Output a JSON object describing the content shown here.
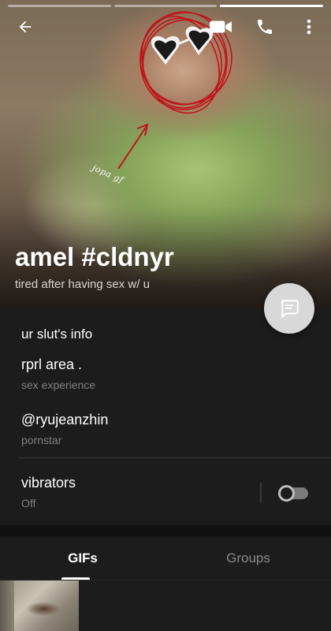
{
  "profile": {
    "name": "amel #cldnyr",
    "bio": "tired after having sex w/ u",
    "photo_doodle_text": "jopa gf"
  },
  "story_bars": {
    "count": 3,
    "active_index": 2
  },
  "toolbar": {
    "back_icon": "arrow-left-icon",
    "video_icon": "video-camera-icon",
    "call_icon": "phone-icon",
    "more_icon": "more-vertical-icon"
  },
  "fab": {
    "icon": "message-icon"
  },
  "info": {
    "section_title": "ur slut's info",
    "rows": [
      {
        "title": "rprl area .",
        "subtitle": "sex experience"
      },
      {
        "title": "@ryujeanzhin",
        "subtitle": "pornstar"
      }
    ],
    "toggle_row": {
      "title": "vibrators",
      "subtitle": "Off",
      "enabled": false
    }
  },
  "tabs": [
    {
      "label": "GIFs",
      "selected": true
    },
    {
      "label": "Groups",
      "selected": false
    }
  ],
  "colors": {
    "background": "#1c1c1c",
    "doodle_red": "#c0141c",
    "fab": "#d8d8d8",
    "muted_text": "#7f7f7f"
  }
}
